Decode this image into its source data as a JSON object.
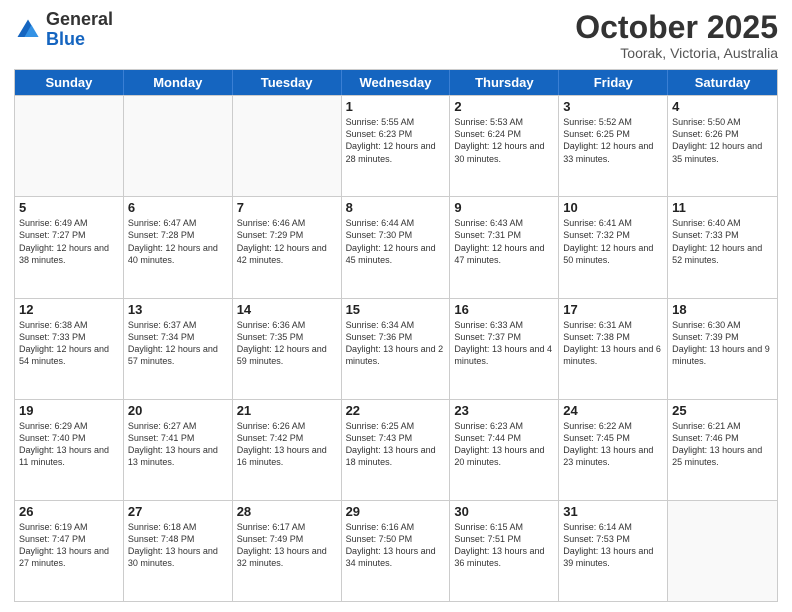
{
  "logo": {
    "general": "General",
    "blue": "Blue"
  },
  "header": {
    "month": "October 2025",
    "location": "Toorak, Victoria, Australia"
  },
  "days": [
    "Sunday",
    "Monday",
    "Tuesday",
    "Wednesday",
    "Thursday",
    "Friday",
    "Saturday"
  ],
  "weeks": [
    [
      {
        "day": "",
        "empty": true
      },
      {
        "day": "",
        "empty": true
      },
      {
        "day": "",
        "empty": true
      },
      {
        "day": "1",
        "sunrise": "Sunrise: 5:55 AM",
        "sunset": "Sunset: 6:23 PM",
        "daylight": "Daylight: 12 hours and 28 minutes."
      },
      {
        "day": "2",
        "sunrise": "Sunrise: 5:53 AM",
        "sunset": "Sunset: 6:24 PM",
        "daylight": "Daylight: 12 hours and 30 minutes."
      },
      {
        "day": "3",
        "sunrise": "Sunrise: 5:52 AM",
        "sunset": "Sunset: 6:25 PM",
        "daylight": "Daylight: 12 hours and 33 minutes."
      },
      {
        "day": "4",
        "sunrise": "Sunrise: 5:50 AM",
        "sunset": "Sunset: 6:26 PM",
        "daylight": "Daylight: 12 hours and 35 minutes."
      }
    ],
    [
      {
        "day": "5",
        "sunrise": "Sunrise: 6:49 AM",
        "sunset": "Sunset: 7:27 PM",
        "daylight": "Daylight: 12 hours and 38 minutes."
      },
      {
        "day": "6",
        "sunrise": "Sunrise: 6:47 AM",
        "sunset": "Sunset: 7:28 PM",
        "daylight": "Daylight: 12 hours and 40 minutes."
      },
      {
        "day": "7",
        "sunrise": "Sunrise: 6:46 AM",
        "sunset": "Sunset: 7:29 PM",
        "daylight": "Daylight: 12 hours and 42 minutes."
      },
      {
        "day": "8",
        "sunrise": "Sunrise: 6:44 AM",
        "sunset": "Sunset: 7:30 PM",
        "daylight": "Daylight: 12 hours and 45 minutes."
      },
      {
        "day": "9",
        "sunrise": "Sunrise: 6:43 AM",
        "sunset": "Sunset: 7:31 PM",
        "daylight": "Daylight: 12 hours and 47 minutes."
      },
      {
        "day": "10",
        "sunrise": "Sunrise: 6:41 AM",
        "sunset": "Sunset: 7:32 PM",
        "daylight": "Daylight: 12 hours and 50 minutes."
      },
      {
        "day": "11",
        "sunrise": "Sunrise: 6:40 AM",
        "sunset": "Sunset: 7:33 PM",
        "daylight": "Daylight: 12 hours and 52 minutes."
      }
    ],
    [
      {
        "day": "12",
        "sunrise": "Sunrise: 6:38 AM",
        "sunset": "Sunset: 7:33 PM",
        "daylight": "Daylight: 12 hours and 54 minutes."
      },
      {
        "day": "13",
        "sunrise": "Sunrise: 6:37 AM",
        "sunset": "Sunset: 7:34 PM",
        "daylight": "Daylight: 12 hours and 57 minutes."
      },
      {
        "day": "14",
        "sunrise": "Sunrise: 6:36 AM",
        "sunset": "Sunset: 7:35 PM",
        "daylight": "Daylight: 12 hours and 59 minutes."
      },
      {
        "day": "15",
        "sunrise": "Sunrise: 6:34 AM",
        "sunset": "Sunset: 7:36 PM",
        "daylight": "Daylight: 13 hours and 2 minutes."
      },
      {
        "day": "16",
        "sunrise": "Sunrise: 6:33 AM",
        "sunset": "Sunset: 7:37 PM",
        "daylight": "Daylight: 13 hours and 4 minutes."
      },
      {
        "day": "17",
        "sunrise": "Sunrise: 6:31 AM",
        "sunset": "Sunset: 7:38 PM",
        "daylight": "Daylight: 13 hours and 6 minutes."
      },
      {
        "day": "18",
        "sunrise": "Sunrise: 6:30 AM",
        "sunset": "Sunset: 7:39 PM",
        "daylight": "Daylight: 13 hours and 9 minutes."
      }
    ],
    [
      {
        "day": "19",
        "sunrise": "Sunrise: 6:29 AM",
        "sunset": "Sunset: 7:40 PM",
        "daylight": "Daylight: 13 hours and 11 minutes."
      },
      {
        "day": "20",
        "sunrise": "Sunrise: 6:27 AM",
        "sunset": "Sunset: 7:41 PM",
        "daylight": "Daylight: 13 hours and 13 minutes."
      },
      {
        "day": "21",
        "sunrise": "Sunrise: 6:26 AM",
        "sunset": "Sunset: 7:42 PM",
        "daylight": "Daylight: 13 hours and 16 minutes."
      },
      {
        "day": "22",
        "sunrise": "Sunrise: 6:25 AM",
        "sunset": "Sunset: 7:43 PM",
        "daylight": "Daylight: 13 hours and 18 minutes."
      },
      {
        "day": "23",
        "sunrise": "Sunrise: 6:23 AM",
        "sunset": "Sunset: 7:44 PM",
        "daylight": "Daylight: 13 hours and 20 minutes."
      },
      {
        "day": "24",
        "sunrise": "Sunrise: 6:22 AM",
        "sunset": "Sunset: 7:45 PM",
        "daylight": "Daylight: 13 hours and 23 minutes."
      },
      {
        "day": "25",
        "sunrise": "Sunrise: 6:21 AM",
        "sunset": "Sunset: 7:46 PM",
        "daylight": "Daylight: 13 hours and 25 minutes."
      }
    ],
    [
      {
        "day": "26",
        "sunrise": "Sunrise: 6:19 AM",
        "sunset": "Sunset: 7:47 PM",
        "daylight": "Daylight: 13 hours and 27 minutes."
      },
      {
        "day": "27",
        "sunrise": "Sunrise: 6:18 AM",
        "sunset": "Sunset: 7:48 PM",
        "daylight": "Daylight: 13 hours and 30 minutes."
      },
      {
        "day": "28",
        "sunrise": "Sunrise: 6:17 AM",
        "sunset": "Sunset: 7:49 PM",
        "daylight": "Daylight: 13 hours and 32 minutes."
      },
      {
        "day": "29",
        "sunrise": "Sunrise: 6:16 AM",
        "sunset": "Sunset: 7:50 PM",
        "daylight": "Daylight: 13 hours and 34 minutes."
      },
      {
        "day": "30",
        "sunrise": "Sunrise: 6:15 AM",
        "sunset": "Sunset: 7:51 PM",
        "daylight": "Daylight: 13 hours and 36 minutes."
      },
      {
        "day": "31",
        "sunrise": "Sunrise: 6:14 AM",
        "sunset": "Sunset: 7:53 PM",
        "daylight": "Daylight: 13 hours and 39 minutes."
      },
      {
        "day": "",
        "empty": true
      }
    ]
  ]
}
